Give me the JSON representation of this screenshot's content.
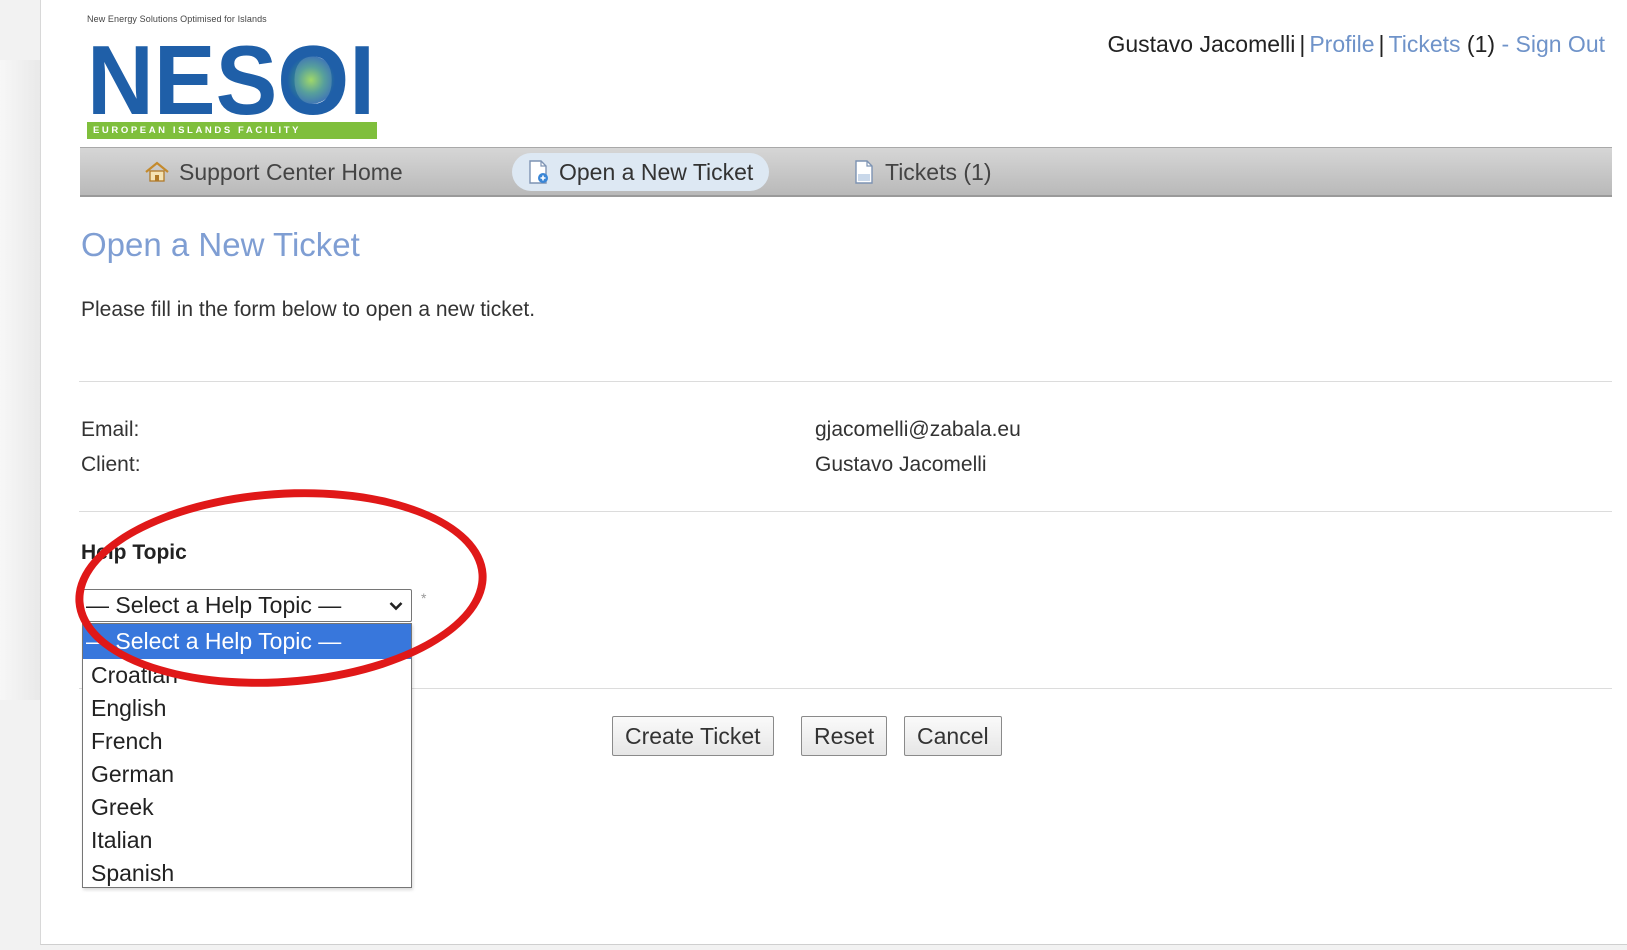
{
  "logo": {
    "tagline": "New Energy Solutions Optimised for Islands",
    "wordmark": "NESOI",
    "band": "EUROPEAN ISLANDS FACILITY"
  },
  "usernav": {
    "user_name": "Gustavo Jacomelli",
    "profile": "Profile",
    "tickets": "Tickets",
    "tickets_count": "(1)",
    "sign_out": "Sign Out"
  },
  "nav": {
    "home": "Support Center Home",
    "new_ticket": "Open a New Ticket",
    "tickets": "Tickets (1)"
  },
  "main": {
    "title": "Open a New Ticket",
    "intro": "Please fill in the form below to open a new ticket.",
    "email_label": "Email:",
    "email_value": "gjacomelli@zabala.eu",
    "client_label": "Client:",
    "client_value": "Gustavo Jacomelli",
    "help_topic_heading": "Help Topic",
    "select_value": "— Select a Help Topic —",
    "required_mark": "*",
    "options": [
      "— Select a Help Topic —",
      "Croatian",
      "English",
      "French",
      "German",
      "Greek",
      "Italian",
      "Spanish"
    ]
  },
  "buttons": {
    "create": "Create Ticket",
    "reset": "Reset",
    "cancel": "Cancel"
  },
  "colors": {
    "accent_link": "#6f93c9",
    "title_blue": "#7f9ed3",
    "logo_blue": "#1f5fa8",
    "logo_green": "#7fbf3c",
    "selected_option": "#3877dc",
    "highlight_red": "#e01818"
  }
}
